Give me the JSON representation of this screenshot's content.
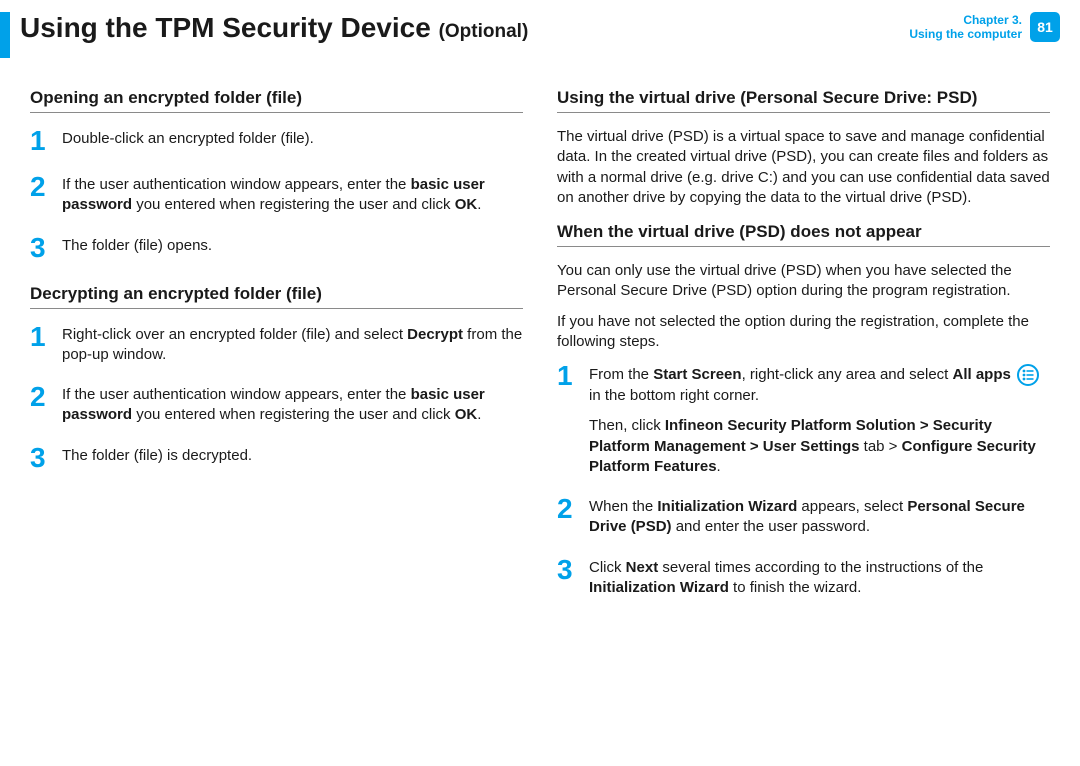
{
  "header": {
    "title_main": "Using the TPM Security Device",
    "title_suffix": "(Optional)",
    "chapter_line1": "Chapter 3.",
    "chapter_line2": "Using the computer",
    "page_number": "81"
  },
  "left": {
    "section_a_title": "Opening an encrypted folder (file)",
    "section_a_steps": {
      "s1": "Double-click an encrypted folder (file).",
      "s2_pre": "If the user authentication window appears, enter the ",
      "s2_b1": "basic user password",
      "s2_mid": " you entered when registering the user and click ",
      "s2_b2": "OK",
      "s2_post": ".",
      "s3": "The folder (file) opens."
    },
    "section_b_title": "Decrypting an encrypted folder (file)",
    "section_b_steps": {
      "s1_pre": "Right-click over an encrypted folder (file) and select ",
      "s1_b1": "Decrypt",
      "s1_post": " from the pop-up window.",
      "s2_pre": "If the user authentication window appears, enter the ",
      "s2_b1": "basic user password",
      "s2_mid": " you entered when registering the user and click ",
      "s2_b2": "OK",
      "s2_post": ".",
      "s3": "The folder (file) is decrypted."
    }
  },
  "right": {
    "section_c_title": "Using the virtual drive (Personal Secure Drive: PSD)",
    "section_c_para": "The virtual drive (PSD) is a virtual space to save and manage confidential data. In the created virtual drive (PSD), you can create files and folders as with a normal drive (e.g. drive C:) and you can use confidential data saved on another drive by copying the data to the virtual drive (PSD).",
    "section_d_title": "When the virtual drive (PSD) does not appear",
    "section_d_para1": "You can only use the virtual drive (PSD) when you have selected the Personal Secure Drive (PSD) option during the program registration.",
    "section_d_para2": " If you have not selected the option during the registration, complete the following steps.",
    "section_d_steps": {
      "s1_pre": "From the ",
      "s1_b1": "Start Screen",
      "s1_mid1": ", right-click any area and select ",
      "s1_b2": "All apps",
      "s1_mid2": " ",
      "s1_post_icon": " in the bottom right corner.",
      "s1_then_pre": "Then, click ",
      "s1_then_b": "Infineon Security Platform Solution > Security Platform Management > User Settings",
      "s1_then_mid": " tab > ",
      "s1_then_b2": "Configure Security Platform Features",
      "s1_then_post": ".",
      "s2_pre": "When the ",
      "s2_b1": "Initialization Wizard",
      "s2_mid": " appears, select ",
      "s2_b2": "Personal Secure Drive (PSD)",
      "s2_post": " and enter the user password.",
      "s3_pre": "Click ",
      "s3_b1": "Next",
      "s3_mid": " several times according to the instructions of the ",
      "s3_b2": "Initialization Wizard",
      "s3_post": " to finish the wizard."
    }
  },
  "nums": {
    "n1": "1",
    "n2": "2",
    "n3": "3"
  }
}
